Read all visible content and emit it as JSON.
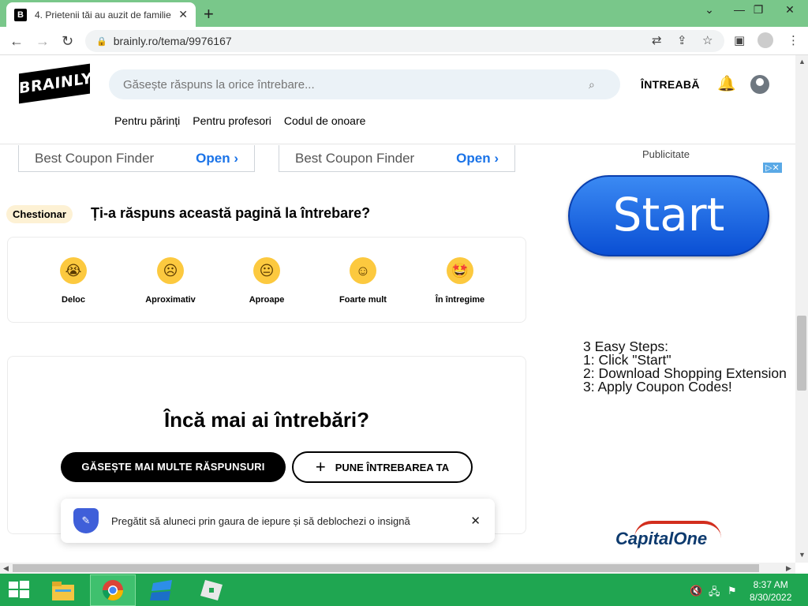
{
  "browser": {
    "tab_title": "4. Prietenii tăi au auzit de familie",
    "tab_favicon": "B",
    "url": "brainly.ro/tema/9976167"
  },
  "header": {
    "logo": "BRAINLY",
    "search_placeholder": "Găsește răspuns la orice întrebare...",
    "ask_label": "ÎNTREABĂ",
    "subnav": [
      "Pentru părinți",
      "Pentru profesori",
      "Codul de onoare"
    ]
  },
  "coupons": [
    {
      "text": "Best Coupon Finder",
      "action": "Open"
    },
    {
      "text": "Best Coupon Finder",
      "action": "Open"
    }
  ],
  "questionnaire": {
    "badge": "Chestionar",
    "title": "Ți-a răspuns această pagină la întrebare?",
    "options": [
      {
        "label": "Deloc",
        "icon": "crying-face-icon"
      },
      {
        "label": "Aproximativ",
        "icon": "sad-face-icon"
      },
      {
        "label": "Aproape",
        "icon": "neutral-face-icon"
      },
      {
        "label": "Foarte mult",
        "icon": "smiling-face-icon"
      },
      {
        "label": "În întregime",
        "icon": "star-eyes-face-icon"
      }
    ]
  },
  "more": {
    "title": "Încă mai ai întrebări?",
    "find_button": "GĂSEȘTE MAI MULTE RĂSPUNSURI",
    "ask_button": "PUNE ÎNTREBAREA TA"
  },
  "toast": {
    "message": "Pregătit să aluneci prin gaura de iepure și să deblochezi o insignă"
  },
  "ad": {
    "label": "Publicitate",
    "start": "Start",
    "steps": [
      "3 Easy Steps:",
      "1: Click \"Start\"",
      "2: Download Shopping Extension",
      "3: Apply Coupon Codes!"
    ],
    "brand": "CapitalOne"
  },
  "taskbar": {
    "time": "8:37 AM",
    "date": "8/30/2022"
  },
  "colors": {
    "tabstrip": "#79c78a",
    "taskbar": "#1fa651",
    "emoji": "#fcc93f",
    "link": "#1a73e8"
  }
}
